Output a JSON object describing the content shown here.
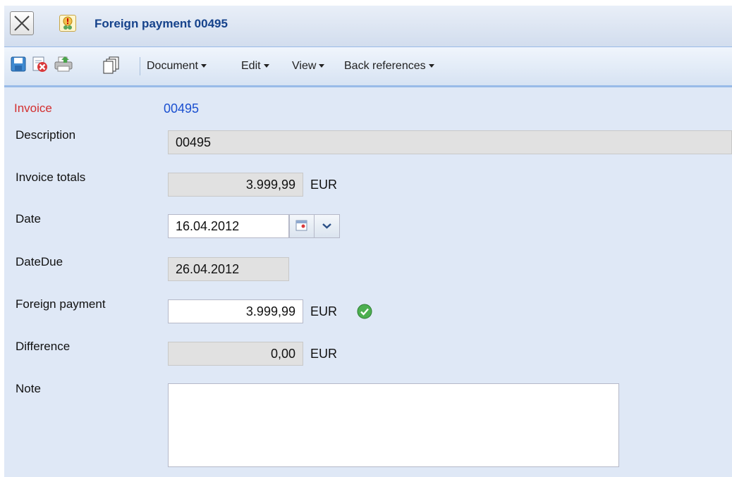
{
  "window": {
    "title": "Foreign payment 00495"
  },
  "toolbar": {
    "icons": [
      "save-icon",
      "delete-icon",
      "print-icon",
      "copy-icon"
    ],
    "menus": [
      "Document",
      "Edit",
      "View",
      "Back references"
    ]
  },
  "form": {
    "invoice": {
      "label": "Invoice",
      "value": "00495"
    },
    "description": {
      "label": "Description",
      "value": "00495"
    },
    "invoice_totals": {
      "label": "Invoice totals",
      "value": "3.999,99",
      "currency": "EUR"
    },
    "date": {
      "label": "Date",
      "value": "16.04.2012"
    },
    "date_due": {
      "label": "DateDue",
      "value": "26.04.2012"
    },
    "foreign_payment": {
      "label": "Foreign payment",
      "value": "3.999,99",
      "currency": "EUR",
      "status_icon": "check-circle-icon"
    },
    "difference": {
      "label": "Difference",
      "value": "0,00",
      "currency": "EUR"
    },
    "note": {
      "label": "Note",
      "value": ""
    }
  },
  "colors": {
    "title": "#15428b",
    "invoice_label": "#d32f2f",
    "invoice_value": "#1a4fd0",
    "panel_bg": "#dfe8f6",
    "readonly_bg": "#e1e1e1"
  }
}
